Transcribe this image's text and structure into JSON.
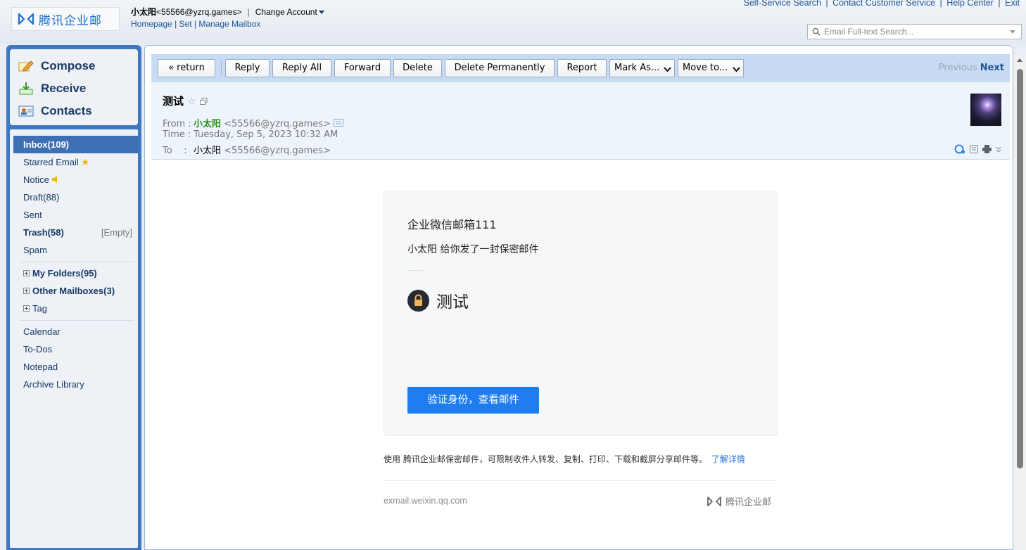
{
  "header": {
    "logo_text": "腾讯企业邮",
    "user_name": "小太阳",
    "user_email": "<55566@yzrq.games>",
    "separator": "|",
    "change_account": "Change Account",
    "links": {
      "homepage": "Homepage",
      "set": "Set",
      "manage_mailbox": "Manage Mailbox"
    },
    "top_links": [
      "Self-Service Search",
      "Contact Customer Service",
      "Help Center",
      "Exit"
    ],
    "search_placeholder": "Email Full-text Search..."
  },
  "sidebar": {
    "quick_actions": [
      {
        "label": "Compose",
        "icon": "compose-icon"
      },
      {
        "label": "Receive",
        "icon": "receive-icon"
      },
      {
        "label": "Contacts",
        "icon": "contacts-icon"
      }
    ],
    "folders": {
      "inbox": "Inbox(109)",
      "starred": "Starred Email",
      "notice": "Notice",
      "draft": "Draft(88)",
      "sent": "Sent",
      "trash": "Trash(58)",
      "trash_empty": "[Empty]",
      "spam": "Spam",
      "my_folders": "My Folders(95)",
      "other_mailboxes": "Other Mailboxes(3)",
      "tag": "Tag",
      "calendar": "Calendar",
      "todos": "To-Dos",
      "notepad": "Notepad",
      "archive": "Archive Library"
    }
  },
  "toolbar": {
    "return": "« return",
    "reply": "Reply",
    "reply_all": "Reply All",
    "forward": "Forward",
    "delete": "Delete",
    "delete_permanently": "Delete Permanently",
    "report": "Report",
    "mark_as": "Mark As...",
    "move_to": "Move to...",
    "previous": "Previous",
    "next": "Next"
  },
  "mail": {
    "subject": "测试",
    "from_label": "From",
    "time_label": "Time",
    "to_label": "To",
    "colon": ":",
    "sender_name": "小太阳",
    "sender_addr": "<55566@yzrq.games>",
    "time_value": "Tuesday, Sep 5, 2023 10:32 AM",
    "to_name": "小太阳",
    "to_addr": "<55566@yzrq.games>"
  },
  "body": {
    "corp_name": "企业微信邮箱111",
    "sent_line": "小太阳 给你发了一封保密邮件",
    "secure_title": "测试",
    "verify_button": "验证身份，查看邮件",
    "footer_note": "使用 腾讯企业邮保密邮件，可限制收件人转发、复制、打印、下载和截屏分享邮件等。",
    "footer_link": "了解详情",
    "footer_domain": "exmail.weixin.qq.com",
    "footer_logo": "腾讯企业邮"
  },
  "colors": {
    "accent": "#1f7df0",
    "sidebar": "#3f78c2",
    "toolbar": "#c7dbf3"
  }
}
